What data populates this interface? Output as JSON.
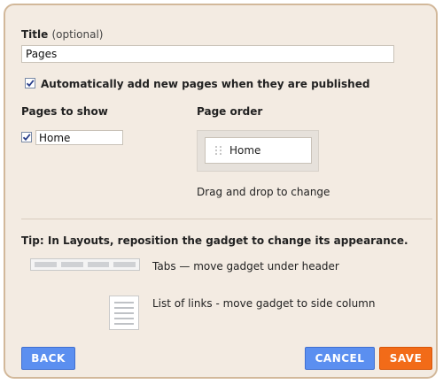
{
  "title_field": {
    "label": "Title",
    "optional_label": "(optional)",
    "value": "Pages"
  },
  "auto_add": {
    "checked": true,
    "label": "Automatically add new pages when they are published"
  },
  "pages_to_show": {
    "heading": "Pages to show",
    "items": [
      {
        "label": "Home",
        "checked": true
      }
    ]
  },
  "page_order": {
    "heading": "Page order",
    "items": [
      {
        "label": "Home"
      }
    ],
    "hint": "Drag and drop to change"
  },
  "tip": {
    "text": "Tip: In Layouts, reposition the gadget to change its appearance.",
    "tabs_text": "Tabs — move gadget under header",
    "links_text": "List of links - move gadget to side column"
  },
  "buttons": {
    "back": "BACK",
    "cancel": "CANCEL",
    "save": "SAVE"
  },
  "colors": {
    "panel_bg": "#f3ebe2",
    "border": "#d2b89a",
    "blue_button": "#5b8ff0",
    "orange_button": "#f26b18"
  }
}
